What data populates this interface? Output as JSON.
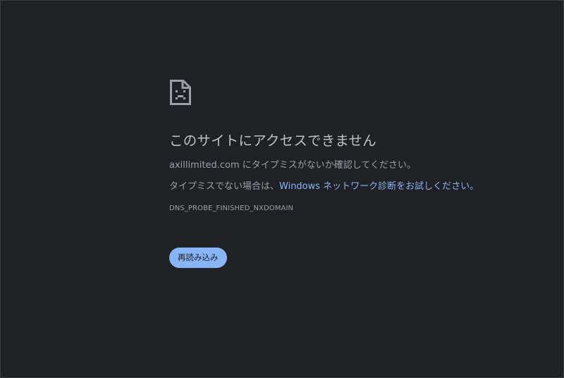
{
  "error_page": {
    "title": "このサイトにアクセスできません",
    "domain": "axillimited.com",
    "message_suffix": " にタイプミスがないか確認してください。",
    "hint_prefix": "タイプミスでない場合は、",
    "hint_link": "Windows ネットワーク診断をお試しください。",
    "error_code": "DNS_PROBE_FINISHED_NXDOMAIN",
    "reload_label": "再読み込み",
    "icon": "sad-page-icon"
  },
  "colors": {
    "background": "#202124",
    "title": "#bdc1c6",
    "text": "#9aa0a6",
    "link": "#8ab4f8",
    "button_bg": "#8ab4f8",
    "button_text": "#202124"
  }
}
